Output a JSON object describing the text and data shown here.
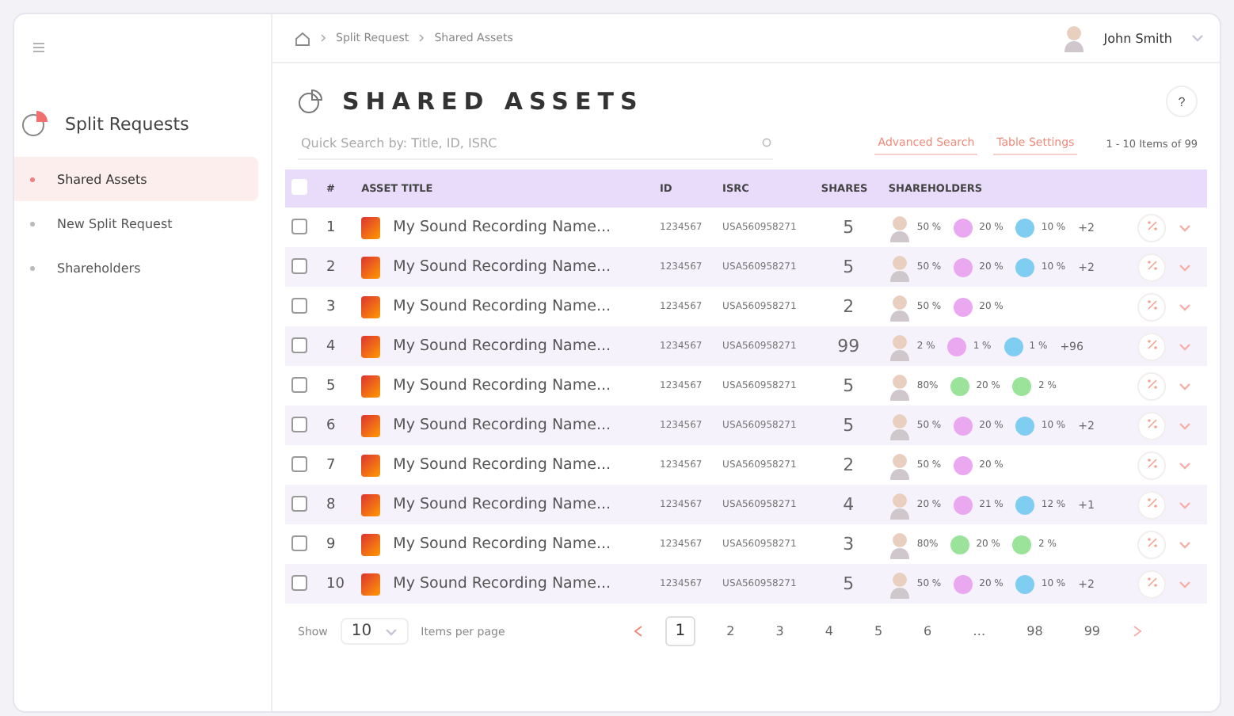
{
  "sidebar": {
    "section_title": "Split Requests",
    "items": [
      {
        "label": "Shared Assets",
        "selected": true
      },
      {
        "label": "New Split Request",
        "selected": false
      },
      {
        "label": "Shareholders",
        "selected": false
      }
    ]
  },
  "breadcrumb": [
    "Split Request",
    "Shared Assets"
  ],
  "user": {
    "name": "John Smith"
  },
  "page_title": "SHARED ASSETS",
  "help": "?",
  "search": {
    "placeholder": "Quick Search by: Title, ID, ISRC"
  },
  "actions": [
    "Advanced Search",
    "Table Settings"
  ],
  "range": "1 - 10 Items of 99",
  "table": {
    "select_all_checked": false,
    "columns": [
      "#",
      "ASSET TITLE",
      "ID",
      "ISRC",
      "SHARES",
      "SHAREHOLDERS"
    ],
    "rows": [
      {
        "checked": false,
        "num": "1",
        "title": "My Sound Recording Name...",
        "id": "1234567",
        "isrc": "USA560958271",
        "shares": "5",
        "holders": [
          {
            "kind": "person",
            "pct": "50 %"
          },
          {
            "kind": "initials",
            "color": "#e9a8f0",
            "pct": "20 %"
          },
          {
            "kind": "initials",
            "color": "#7fcdf0",
            "pct": "10 %"
          }
        ],
        "more": "+2"
      },
      {
        "checked": false,
        "num": "2",
        "title": "My Sound Recording Name...",
        "id": "1234567",
        "isrc": "USA560958271",
        "shares": "5",
        "holders": [
          {
            "kind": "person",
            "pct": "50 %"
          },
          {
            "kind": "initials",
            "color": "#e9a8f0",
            "pct": "20 %"
          },
          {
            "kind": "initials",
            "color": "#7fcdf0",
            "pct": "10 %"
          }
        ],
        "more": "+2"
      },
      {
        "checked": false,
        "num": "3",
        "title": "My Sound Recording Name...",
        "id": "1234567",
        "isrc": "USA560958271",
        "shares": "2",
        "holders": [
          {
            "kind": "person",
            "pct": "50 %"
          },
          {
            "kind": "initials",
            "color": "#e9a8f0",
            "pct": "20 %"
          }
        ]
      },
      {
        "checked": false,
        "num": "4",
        "title": "My Sound Recording Name...",
        "id": "1234567",
        "isrc": "USA560958271",
        "shares": "99",
        "holders": [
          {
            "kind": "person",
            "pct": "2 %"
          },
          {
            "kind": "initials",
            "color": "#e9a8f0",
            "pct": "1 %"
          },
          {
            "kind": "initials",
            "color": "#7fcdf0",
            "pct": "1 %"
          }
        ],
        "more": "+96"
      },
      {
        "checked": false,
        "num": "5",
        "title": "My Sound Recording Name...",
        "id": "1234567",
        "isrc": "USA560958271",
        "shares": "5",
        "holders": [
          {
            "kind": "person",
            "pct": "80%"
          },
          {
            "kind": "initials",
            "color": "#9be39b",
            "pct": "20 %"
          },
          {
            "kind": "initials",
            "color": "#9be39b",
            "pct": "2 %"
          }
        ]
      },
      {
        "checked": false,
        "num": "6",
        "title": "My Sound Recording Name...",
        "id": "1234567",
        "isrc": "USA560958271",
        "shares": "5",
        "holders": [
          {
            "kind": "person",
            "pct": "50 %"
          },
          {
            "kind": "initials",
            "color": "#e9a8f0",
            "pct": "20 %"
          },
          {
            "kind": "initials",
            "color": "#7fcdf0",
            "pct": "10 %"
          }
        ],
        "more": "+2"
      },
      {
        "checked": false,
        "num": "7",
        "title": "My Sound Recording Name...",
        "id": "1234567",
        "isrc": "USA560958271",
        "shares": "2",
        "holders": [
          {
            "kind": "person",
            "pct": "50 %"
          },
          {
            "kind": "initials",
            "color": "#e9a8f0",
            "pct": "20 %"
          }
        ]
      },
      {
        "checked": false,
        "num": "8",
        "title": "My Sound Recording Name...",
        "id": "1234567",
        "isrc": "USA560958271",
        "shares": "4",
        "holders": [
          {
            "kind": "person",
            "pct": "20 %"
          },
          {
            "kind": "initials",
            "color": "#e9a8f0",
            "pct": "21 %"
          },
          {
            "kind": "initials",
            "color": "#7fcdf0",
            "pct": "12 %"
          }
        ],
        "more": "+1"
      },
      {
        "checked": false,
        "num": "9",
        "title": "My Sound Recording Name...",
        "id": "1234567",
        "isrc": "USA560958271",
        "shares": "3",
        "holders": [
          {
            "kind": "person",
            "pct": "80%"
          },
          {
            "kind": "initials",
            "color": "#9be39b",
            "pct": "20 %"
          },
          {
            "kind": "initials",
            "color": "#9be39b",
            "pct": "2 %"
          }
        ]
      },
      {
        "checked": false,
        "num": "10",
        "title": "My Sound Recording Name...",
        "id": "1234567",
        "isrc": "USA560958271",
        "shares": "5",
        "holders": [
          {
            "kind": "person",
            "pct": "50 %"
          },
          {
            "kind": "initials",
            "color": "#e9a8f0",
            "pct": "20 %"
          },
          {
            "kind": "initials",
            "color": "#7fcdf0",
            "pct": "10 %"
          }
        ],
        "more": "+2"
      }
    ]
  },
  "footer": {
    "show_label": "Show",
    "page_size": "10",
    "per_page_label": "Items per page",
    "pages": [
      {
        "label": "1",
        "selected": true
      },
      {
        "label": "2",
        "selected": false
      },
      {
        "label": "3",
        "selected": false
      },
      {
        "label": "4",
        "selected": false
      },
      {
        "label": "5",
        "selected": false
      },
      {
        "label": "6",
        "selected": false
      },
      {
        "label": "…",
        "selected": false
      },
      {
        "label": "98",
        "selected": false
      },
      {
        "label": "99",
        "selected": false
      }
    ]
  }
}
